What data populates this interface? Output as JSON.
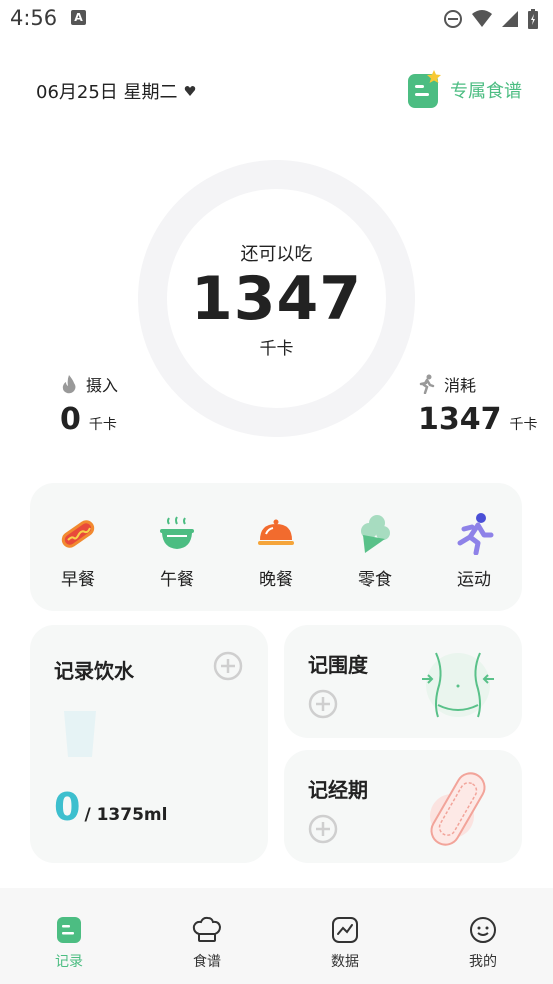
{
  "status": {
    "time": "4:56",
    "notif_icon_letter": "A"
  },
  "header": {
    "date": "06月25日 星期二",
    "recipe_link": "专属食谱"
  },
  "summary": {
    "remain_label": "还可以吃",
    "remain_value": "1347",
    "remain_unit": "千卡",
    "intake_label": "摄入",
    "intake_value": "0",
    "intake_unit": "千卡",
    "burn_label": "消耗",
    "burn_value": "1347",
    "burn_unit": "千卡"
  },
  "meals": [
    {
      "label": "早餐",
      "icon": "hotdog-icon"
    },
    {
      "label": "午餐",
      "icon": "bowl-icon"
    },
    {
      "label": "晚餐",
      "icon": "dish-cover-icon"
    },
    {
      "label": "零食",
      "icon": "ice-cream-icon"
    },
    {
      "label": "运动",
      "icon": "running-icon"
    }
  ],
  "water": {
    "title": "记录饮水",
    "current": "0",
    "target": "/ 1375ml"
  },
  "waist": {
    "title": "记围度"
  },
  "period": {
    "title": "记经期"
  },
  "nav": [
    {
      "label": "记录",
      "icon": "record-icon",
      "active": true
    },
    {
      "label": "食谱",
      "icon": "chef-hat-icon",
      "active": false
    },
    {
      "label": "数据",
      "icon": "chart-icon",
      "active": false
    },
    {
      "label": "我的",
      "icon": "smile-icon",
      "active": false
    }
  ],
  "colors": {
    "accent": "#4cbd82",
    "water": "#3dbfce",
    "card_bg": "#f6f8f7"
  }
}
